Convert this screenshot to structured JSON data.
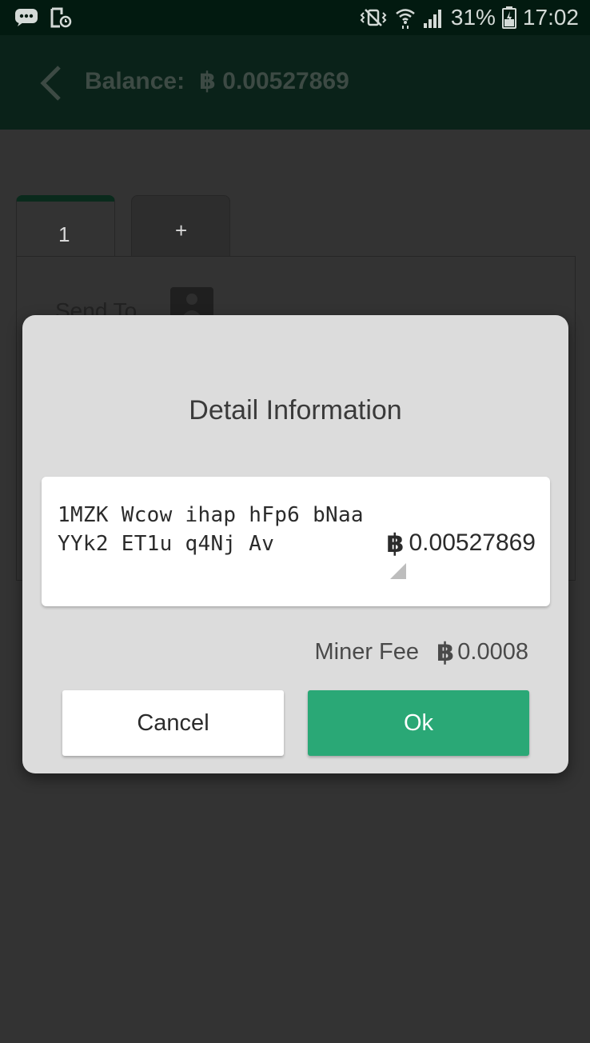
{
  "status_bar": {
    "battery_percent": "31%",
    "time": "17:02",
    "icons": [
      "message-icon",
      "screenshot-icon",
      "mute-vibrate-icon",
      "wifi-icon",
      "signal-icon",
      "battery-icon"
    ]
  },
  "app_bar": {
    "title_label": "Balance:",
    "currency_symbol": "฿",
    "balance": "0.00527869"
  },
  "tabs": [
    {
      "label": "1"
    },
    {
      "label": "+"
    }
  ],
  "form": {
    "send_to_label": "Send To"
  },
  "dialog": {
    "title": "Detail Information",
    "address_line1": "1MZK Wcow ihap hFp6 bNaa",
    "address_line2": "YYk2 ET1u q4Nj Av",
    "currency_symbol": "฿",
    "amount": "0.00527869",
    "miner_fee_label": "Miner Fee",
    "miner_fee": "0.0008",
    "cancel_label": "Cancel",
    "ok_label": "Ok"
  },
  "colors": {
    "status_bar": "#021a10",
    "app_bar": "#0a2219",
    "overlay_background": "#333333",
    "dialog_background": "#dcdcdc",
    "ok_button": "#2aa876"
  }
}
